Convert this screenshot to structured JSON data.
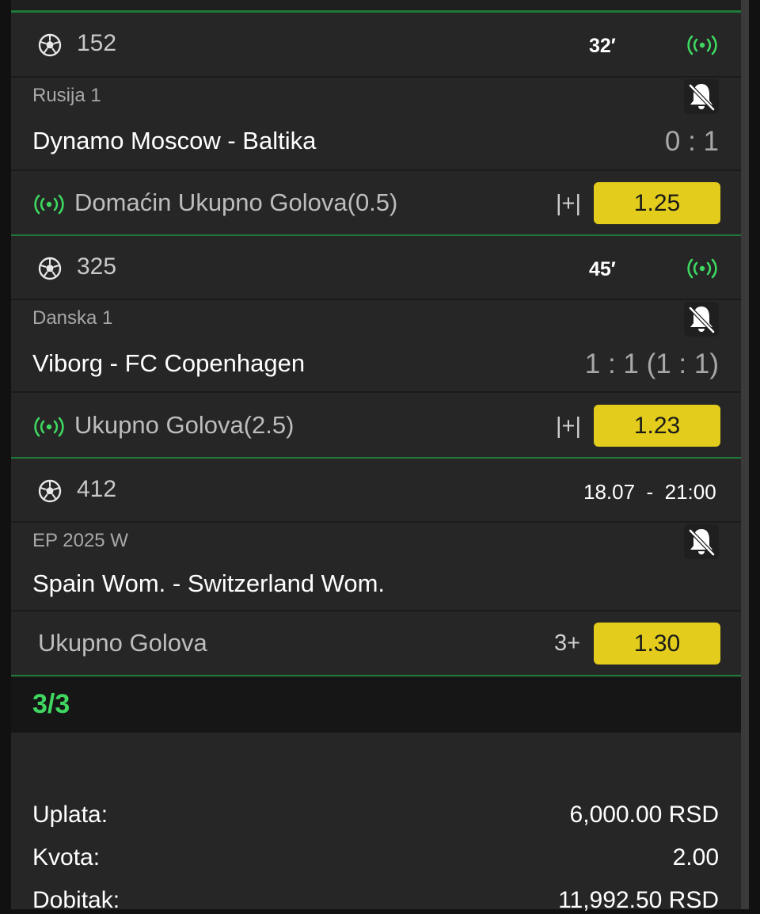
{
  "colors": {
    "accent_green": "#3fd760",
    "divider_green": "#1f7a3a",
    "odd_yellow": "#e3cc1b",
    "panel": "#262626"
  },
  "icons": {
    "sport": "soccer-ball-icon",
    "live": "live-broadcast-icon",
    "notification": "bell-off-icon"
  },
  "bets": [
    {
      "code": "152",
      "time": "32′",
      "league": "Rusija 1",
      "match": "Dynamo Moscow - Baltika",
      "score": "0 : 1",
      "market": "Domaćin Ukupno Golova(0.5)",
      "selection": "|+|",
      "odd": "1.25"
    },
    {
      "code": "325",
      "time": "45′",
      "league": "Danska 1",
      "match": "Viborg - FC Copenhagen",
      "score": "1 : 1 (1 : 1)",
      "market": "Ukupno Golova(2.5)",
      "selection": "|+|",
      "odd": "1.23"
    },
    {
      "code": "412",
      "time": "18.07  -  21:00",
      "league": "EP 2025 W",
      "match": "Spain Wom. - Switzerland Wom.",
      "score": "",
      "market": "Ukupno Golova",
      "selection": "3+",
      "odd": "1.30"
    }
  ],
  "summary": {
    "count": "3/3",
    "payment_label": "Uplata:",
    "payment_value": "6,000.00 RSD",
    "odds_label": "Kvota:",
    "odds_value": "2.00",
    "win_label": "Dobitak:",
    "win_value": "11,992.50 RSD"
  }
}
